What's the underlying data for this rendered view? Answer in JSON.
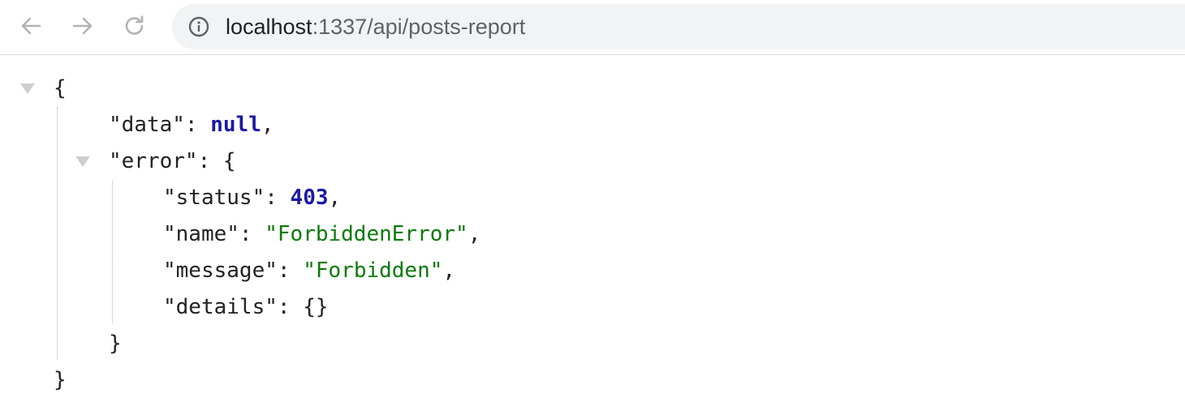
{
  "browser": {
    "url_host": "localhost",
    "url_path": ":1337/api/posts-report"
  },
  "json": {
    "open_brace": "{",
    "close_brace": "}",
    "data_key": "\"data\"",
    "data_value": "null",
    "error_key": "\"error\"",
    "error_open": "{",
    "error_close": "}",
    "status_key": "\"status\"",
    "status_value": "403",
    "name_key": "\"name\"",
    "name_value": "\"ForbiddenError\"",
    "message_key": "\"message\"",
    "message_value": "\"Forbidden\"",
    "details_key": "\"details\"",
    "details_value": "{}",
    "colon": ": ",
    "comma": ","
  },
  "colors": {
    "keyword": "#1a1aa6",
    "string": "#0b7a0b",
    "text": "#222222"
  },
  "icons": [
    "back-arrow-icon",
    "forward-arrow-icon",
    "reload-icon",
    "info-icon",
    "collapse-triangle-icon"
  ]
}
